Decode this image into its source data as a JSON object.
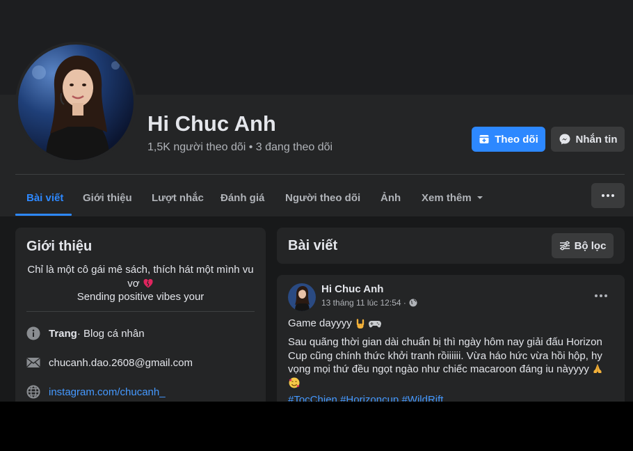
{
  "profile": {
    "name": "Hi Chuc Anh",
    "followers_line": "1,5K người theo dõi • 3 đang theo dõi",
    "avatar_icon": "profile-photo"
  },
  "actions": {
    "follow_label": "Theo dõi",
    "follow_icon": "follow-icon",
    "message_label": "Nhắn tin",
    "message_icon": "messenger-icon"
  },
  "tabs": [
    {
      "label": "Bài viết",
      "active": true
    },
    {
      "label": "Giới thiệu"
    },
    {
      "label": "Lượt nhắc"
    },
    {
      "label": "Đánh giá"
    },
    {
      "label": "Người theo dõi"
    },
    {
      "label": "Ảnh"
    },
    {
      "label": "Xem thêm"
    }
  ],
  "intro": {
    "title": "Giới thiệu",
    "bio_line1": "Chỉ là một cô gái mê sách, thích hát một mình vu",
    "bio_line2": "vơ",
    "bio_line3": "Sending positive vibes your",
    "items": [
      {
        "icon": "info-icon",
        "strong": "Trang",
        "text": " · Blog cá nhân"
      },
      {
        "icon": "mail-icon",
        "text": "chucanh.dao.2608@gmail.com"
      },
      {
        "icon": "globe-icon",
        "text": "instagram.com/chucanh_"
      }
    ]
  },
  "posts_section": {
    "title": "Bài viết",
    "filter_label": "Bộ lọc"
  },
  "post": {
    "author": "Hi Chuc Anh",
    "timestamp": "13 tháng 11 lúc 12:54 ·",
    "line1": "Game dayyyy",
    "body": "Sau quãng thời gian dài chuẩn bị thì ngày hôm nay giải đấu Horizon Cup cũng chính thức khởi tranh rồiiiiii. Vừa háo hức vừa hồi hộp, hy vọng mọi thứ đều ngọt ngào như chiếc macaroon đáng iu nàyyyy",
    "tags": [
      "#TocChien",
      "#Horizoncup",
      "#WildRift"
    ]
  },
  "colors": {
    "accent": "#2d88ff",
    "link": "#4599ff",
    "card_bg": "#242526",
    "page_bg": "#18191a"
  }
}
